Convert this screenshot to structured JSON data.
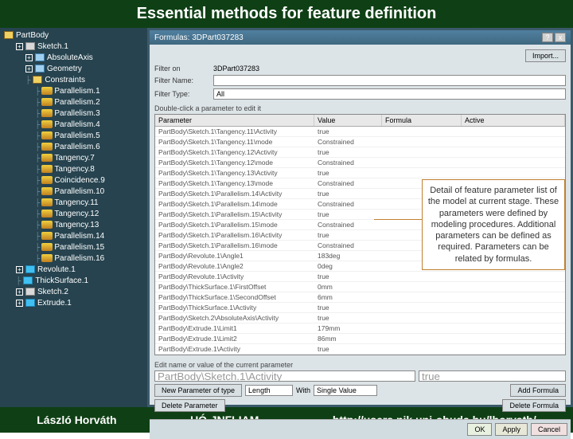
{
  "slide": {
    "title": "Essential methods for feature definition",
    "author": "László Horváth",
    "institute": "UÓ-JNFI-IAM",
    "url": "http://users.nik.uni-obuda.hu/lhorvath/"
  },
  "callout": "Detail of feature parameter list of the model at current stage. These parameters were defined by modeling procedures. Additional parameters can be defined as required. Parameters can be related by formulas.",
  "tree": {
    "root": "PartBody",
    "items": [
      {
        "label": "Sketch.1",
        "depth": 1,
        "icon": "sketch",
        "plus": true
      },
      {
        "label": "AbsoluteAxis",
        "depth": 2,
        "icon": "constraint",
        "plus": true
      },
      {
        "label": "Geometry",
        "depth": 2,
        "icon": "constraint",
        "plus": true
      },
      {
        "label": "Constraints",
        "depth": 2,
        "icon": "box",
        "plus": false
      },
      {
        "label": "Parallelism.1",
        "depth": 3,
        "icon": "par"
      },
      {
        "label": "Parallelism.2",
        "depth": 3,
        "icon": "par"
      },
      {
        "label": "Parallelism.3",
        "depth": 3,
        "icon": "par"
      },
      {
        "label": "Parallelism.4",
        "depth": 3,
        "icon": "par"
      },
      {
        "label": "Parallelism.5",
        "depth": 3,
        "icon": "par"
      },
      {
        "label": "Parallelism.6",
        "depth": 3,
        "icon": "par"
      },
      {
        "label": "Tangency.7",
        "depth": 3,
        "icon": "par"
      },
      {
        "label": "Tangency.8",
        "depth": 3,
        "icon": "par"
      },
      {
        "label": "Coincidence.9",
        "depth": 3,
        "icon": "par"
      },
      {
        "label": "Parallelism.10",
        "depth": 3,
        "icon": "par"
      },
      {
        "label": "Tangency.11",
        "depth": 3,
        "icon": "par"
      },
      {
        "label": "Tangency.12",
        "depth": 3,
        "icon": "par"
      },
      {
        "label": "Tangency.13",
        "depth": 3,
        "icon": "par"
      },
      {
        "label": "Parallelism.14",
        "depth": 3,
        "icon": "par"
      },
      {
        "label": "Parallelism.15",
        "depth": 3,
        "icon": "par"
      },
      {
        "label": "Parallelism.16",
        "depth": 3,
        "icon": "par"
      },
      {
        "label": "Revolute.1",
        "depth": 1,
        "icon": "rev",
        "plus": true
      },
      {
        "label": "ThickSurface.1",
        "depth": 1,
        "icon": "rev"
      },
      {
        "label": "Sketch.2",
        "depth": 1,
        "icon": "sketch",
        "plus": true
      },
      {
        "label": "Extrude.1",
        "depth": 1,
        "icon": "rev",
        "plus": true
      }
    ]
  },
  "dialog": {
    "title": "Formulas: 3DPart037283",
    "help": "?",
    "close": "x",
    "import_btn": "Import...",
    "filter_on_label": "Filter on",
    "filter_on_value": "3DPart037283",
    "filter_name_label": "Filter Name:",
    "filter_name_value": "",
    "filter_type_label": "Filter Type:",
    "filter_type_value": "All",
    "hint": "Double-click a parameter to edit it",
    "headers": {
      "param": "Parameter",
      "value": "Value",
      "formula": "Formula",
      "active": "Active"
    },
    "rows": [
      {
        "p": "PartBody\\Sketch.1\\Tangency.11\\Activity",
        "v": "true"
      },
      {
        "p": "PartBody\\Sketch.1\\Tangency.11\\mode",
        "v": "Constrained"
      },
      {
        "p": "PartBody\\Sketch.1\\Tangency.12\\Activity",
        "v": "true"
      },
      {
        "p": "PartBody\\Sketch.1\\Tangency.12\\mode",
        "v": "Constrained"
      },
      {
        "p": "PartBody\\Sketch.1\\Tangency.13\\Activity",
        "v": "true"
      },
      {
        "p": "PartBody\\Sketch.1\\Tangency.13\\mode",
        "v": "Constrained"
      },
      {
        "p": "PartBody\\Sketch.1\\Parallelism.14\\Activity",
        "v": "true"
      },
      {
        "p": "PartBody\\Sketch.1\\Parallelism.14\\mode",
        "v": "Constrained"
      },
      {
        "p": "PartBody\\Sketch.1\\Parallelism.15\\Activity",
        "v": "true"
      },
      {
        "p": "PartBody\\Sketch.1\\Parallelism.15\\mode",
        "v": "Constrained"
      },
      {
        "p": "PartBody\\Sketch.1\\Parallelism.16\\Activity",
        "v": "true"
      },
      {
        "p": "PartBody\\Sketch.1\\Parallelism.16\\mode",
        "v": "Constrained"
      },
      {
        "p": "PartBody\\Revolute.1\\Angle1",
        "v": "183deg"
      },
      {
        "p": "PartBody\\Revolute.1\\Angle2",
        "v": "0deg"
      },
      {
        "p": "PartBody\\Revolute.1\\Activity",
        "v": "true"
      },
      {
        "p": "PartBody\\ThickSurface.1\\FirstOffset",
        "v": "0mm"
      },
      {
        "p": "PartBody\\ThickSurface.1\\SecondOffset",
        "v": "6mm"
      },
      {
        "p": "PartBody\\ThickSurface.1\\Activity",
        "v": "true"
      },
      {
        "p": "PartBody\\Sketch.2\\AbsoluteAxis\\Activity",
        "v": "true"
      },
      {
        "p": "PartBody\\Extrude.1\\Limit1",
        "v": "179mm"
      },
      {
        "p": "PartBody\\Extrude.1\\Limit2",
        "v": "86mm"
      },
      {
        "p": "PartBody\\Extrude.1\\Activity",
        "v": "true"
      }
    ],
    "edit_label": "Edit name or value of the current parameter",
    "edit_param": "PartBody\\Sketch.1\\Activity",
    "edit_value": "true",
    "new_param_label": "New Parameter of type",
    "new_param_type": "Length",
    "with_label": "With",
    "with_value": "Single Value",
    "add_formula": "Add Formula",
    "delete_param": "Delete Parameter",
    "delete_formula": "Delete Formula",
    "ok": "OK",
    "apply": "Apply",
    "cancel": "Cancel"
  }
}
